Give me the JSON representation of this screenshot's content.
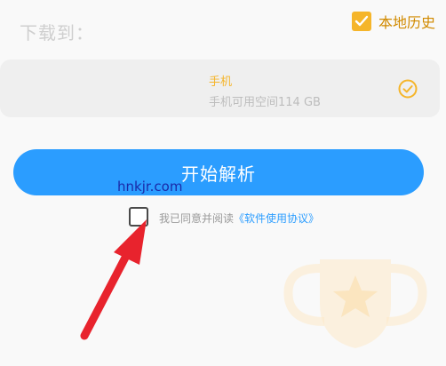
{
  "header": {
    "history_label": "本地历史",
    "history_checked": true
  },
  "download": {
    "label": "下载到：",
    "device": "手机",
    "storage": "手机可用空间114 GB"
  },
  "action": {
    "start_label": "开始解析"
  },
  "watermark": {
    "text": "hnkjr.com"
  },
  "agreement": {
    "text": "我已同意并阅读",
    "link": "《软件使用协议》",
    "checked": false
  },
  "colors": {
    "accent_orange": "#f5b52a",
    "primary_blue": "#2b9dff",
    "arrow_red": "#e8232d"
  },
  "icons": {
    "history_checkbox": "check-icon",
    "device_selected": "check-circle-icon",
    "watermark_graphic": "trophy-icon",
    "annotation": "red-arrow"
  }
}
